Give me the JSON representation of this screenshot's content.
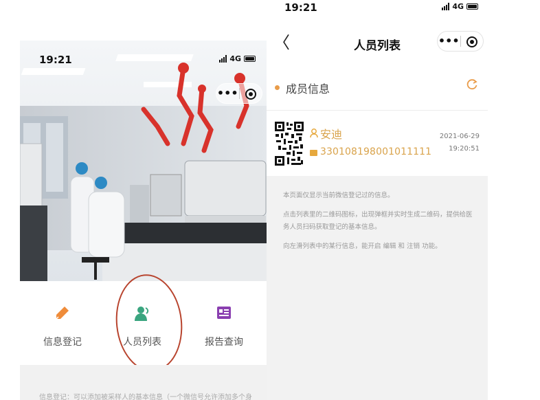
{
  "left_screen": {
    "status_time": "19:21",
    "network": "4G",
    "menu": [
      {
        "label": "信息登记",
        "icon": "pencil-icon",
        "color": "#ef8c3a"
      },
      {
        "label": "人员列表",
        "icon": "person-icon",
        "color": "#3aa57f"
      },
      {
        "label": "报告查询",
        "icon": "report-icon",
        "color": "#8a3fb0"
      }
    ],
    "info_text": "信息登记：可以添加被采样人的基本信息（一个微信号允许添加多个身"
  },
  "right_screen": {
    "status_time": "19:21",
    "network": "4G",
    "nav": {
      "back_glyph": "〈",
      "title": "人员列表"
    },
    "section_title": "成员信息",
    "person": {
      "name": "安迪",
      "id_number": "330108198001011111",
      "date": "2021-06-29",
      "time": "19:20:51"
    },
    "notes": [
      "本页面仅显示当前微信登记过的信息。",
      "点击列表里的二维码图标，出现弹框并实时生成二维码，提供给医务人员扫码获取登记的基本信息。",
      "向左滑列表中的某行信息，能开启 编辑 和 注销 功能。"
    ]
  },
  "capsule": {
    "more_glyph": "•••"
  },
  "colors": {
    "accent_orange": "#e99c4a",
    "person_gold": "#d9a34b",
    "annotation_red": "#b8442e"
  }
}
